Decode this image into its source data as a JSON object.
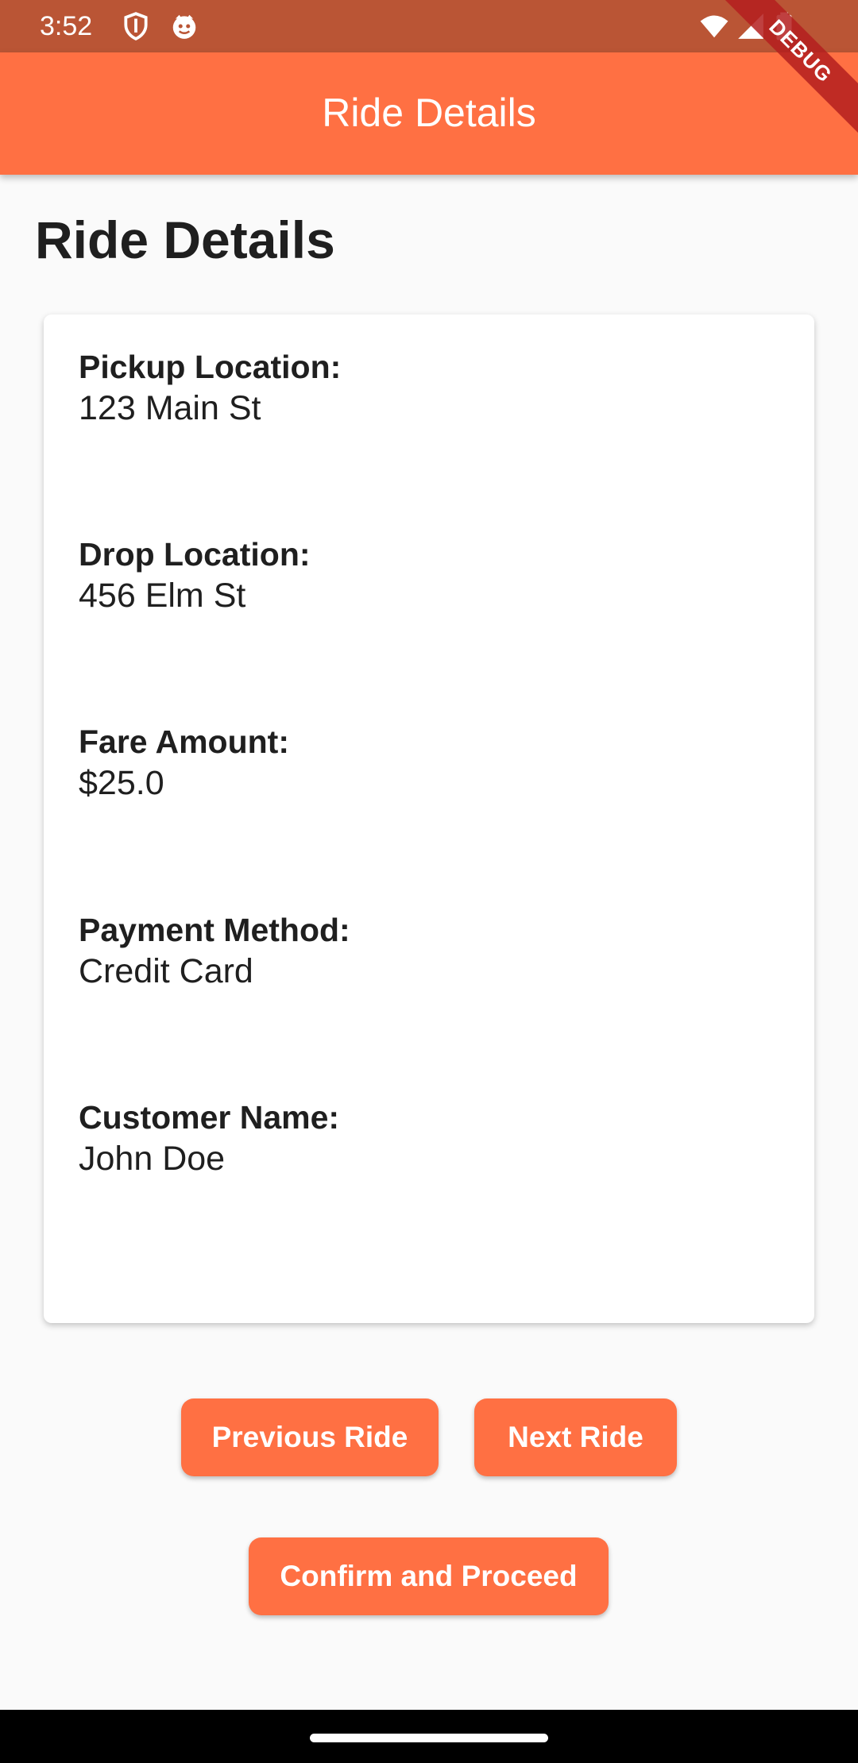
{
  "status_bar": {
    "time": "3:52",
    "icons": [
      "shield-icon",
      "face-icon",
      "wifi-icon",
      "signal-icon",
      "battery-icon"
    ]
  },
  "app_bar": {
    "title": "Ride Details",
    "background": "#ff7043"
  },
  "debug_banner": {
    "label": "DEBUG"
  },
  "page": {
    "heading": "Ride Details"
  },
  "ride": {
    "fields": [
      {
        "label": "Pickup Location:",
        "value": "123 Main St"
      },
      {
        "label": "Drop Location:",
        "value": "456 Elm St"
      },
      {
        "label": "Fare Amount:",
        "value": "$25.0"
      },
      {
        "label": "Payment Method:",
        "value": "Credit Card"
      },
      {
        "label": "Customer Name:",
        "value": "John Doe"
      }
    ]
  },
  "actions": {
    "previous_label": "Previous Ride",
    "next_label": "Next Ride",
    "confirm_label": "Confirm and Proceed",
    "accent": "#ff7043"
  }
}
